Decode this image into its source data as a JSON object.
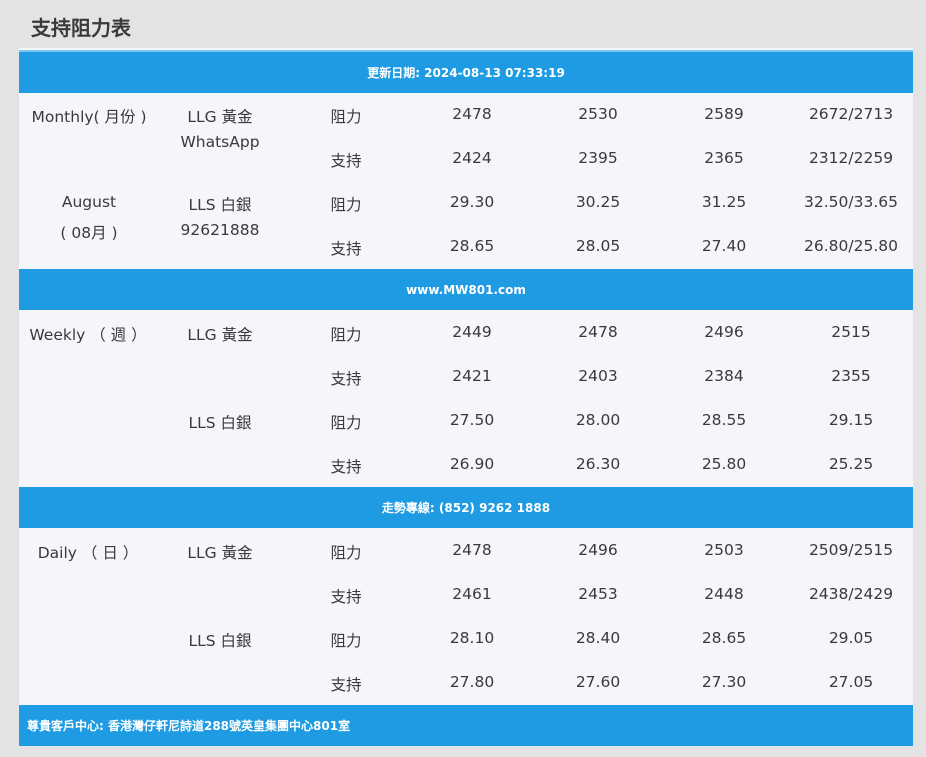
{
  "page_title": "支持阻力表",
  "bands": {
    "update": "更新日期: 2024-08-13 07:33:19",
    "website": "www.MW801.com",
    "hotline": "走勢專線: (852) 9262 1888",
    "address": "尊貴客戶中心: 香港灣仔軒尼詩道288號英皇集團中心801室"
  },
  "monthly": {
    "period": "Monthly( 月份 )",
    "month": "August",
    "month_cn": "( 08月 )",
    "gold": "LLG 黃金",
    "whatsapp": "WhatsApp",
    "silver": "LLS 白銀",
    "phone": "92621888",
    "rows": [
      {
        "type": "阻力",
        "values": [
          "2478",
          "2530",
          "2589",
          "2672/2713"
        ]
      },
      {
        "type": "支持",
        "values": [
          "2424",
          "2395",
          "2365",
          "2312/2259"
        ]
      },
      {
        "type": "阻力",
        "values": [
          "29.30",
          "30.25",
          "31.25",
          "32.50/33.65"
        ]
      },
      {
        "type": "支持",
        "values": [
          "28.65",
          "28.05",
          "27.40",
          "26.80/25.80"
        ]
      }
    ]
  },
  "weekly": {
    "period": "Weekly （ 週 ）",
    "gold": "LLG 黃金",
    "silver": "LLS 白銀",
    "rows": [
      {
        "type": "阻力",
        "values": [
          "2449",
          "2478",
          "2496",
          "2515"
        ]
      },
      {
        "type": "支持",
        "values": [
          "2421",
          "2403",
          "2384",
          "2355"
        ]
      },
      {
        "type": "阻力",
        "values": [
          "27.50",
          "28.00",
          "28.55",
          "29.15"
        ]
      },
      {
        "type": "支持",
        "values": [
          "26.90",
          "26.30",
          "25.80",
          "25.25"
        ]
      }
    ]
  },
  "daily": {
    "period": "Daily （ 日 ）",
    "gold": "LLG 黃金",
    "silver": "LLS 白銀",
    "rows": [
      {
        "type": "阻力",
        "values": [
          "2478",
          "2496",
          "2503",
          "2509/2515"
        ]
      },
      {
        "type": "支持",
        "values": [
          "2461",
          "2453",
          "2448",
          "2438/2429"
        ]
      },
      {
        "type": "阻力",
        "values": [
          "28.10",
          "28.40",
          "28.65",
          "29.05"
        ]
      },
      {
        "type": "支持",
        "values": [
          "27.80",
          "27.60",
          "27.30",
          "27.05"
        ]
      }
    ]
  },
  "colors": {
    "band": "#1e9be2",
    "panel": "#f4f6fb",
    "background": "#e3e3e3"
  }
}
